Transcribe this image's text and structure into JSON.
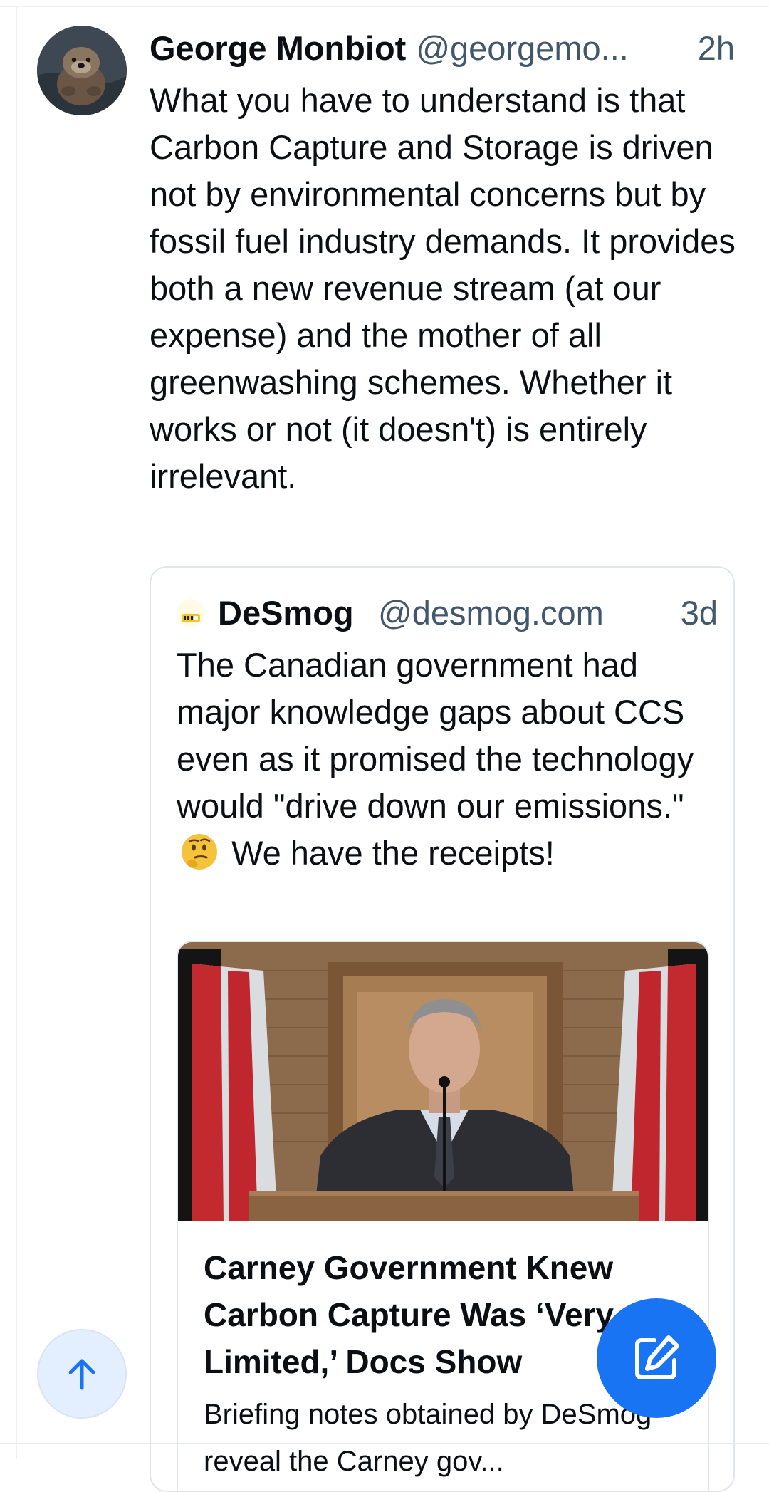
{
  "post": {
    "author_name": "George Monbiot",
    "author_handle": "@georgemo...",
    "time": "2h",
    "text": "What you have to understand is that Carbon Capture and Storage is driven not by environmental concerns but by fossil fuel industry demands. It provides both a new revenue stream (at our expense) and the mother of all greenwashing schemes. Whether it works or not (it doesn't) is entirely irrelevant.",
    "avatar_icon": "sea-otter-avatar"
  },
  "quote": {
    "author_name": "DeSmog",
    "author_handle": "@desmog.com",
    "time": "3d",
    "logo_icon": "desmog-logo",
    "text_before_emoji": "The Canadian government had major knowledge gaps about CCS even as it promised the technology would \"drive down our emissions.\"",
    "emoji_icon": "thinking-face-emoji",
    "text_after_emoji": "We have the receipts!",
    "embed": {
      "image_icon": "press-conference-photo",
      "title": "Carney Government Knew Carbon Capture Was ‘Very Limited,’ Docs Show",
      "description": "Briefing notes obtained by DeSmog reveal the Carney gov..."
    }
  },
  "buttons": {
    "scroll_top_icon": "arrow-up-icon",
    "compose_icon": "compose-icon"
  },
  "colors": {
    "accent": "#1874f2",
    "muted_text": "#42576c",
    "scroll_button_bg": "#e3efff"
  }
}
